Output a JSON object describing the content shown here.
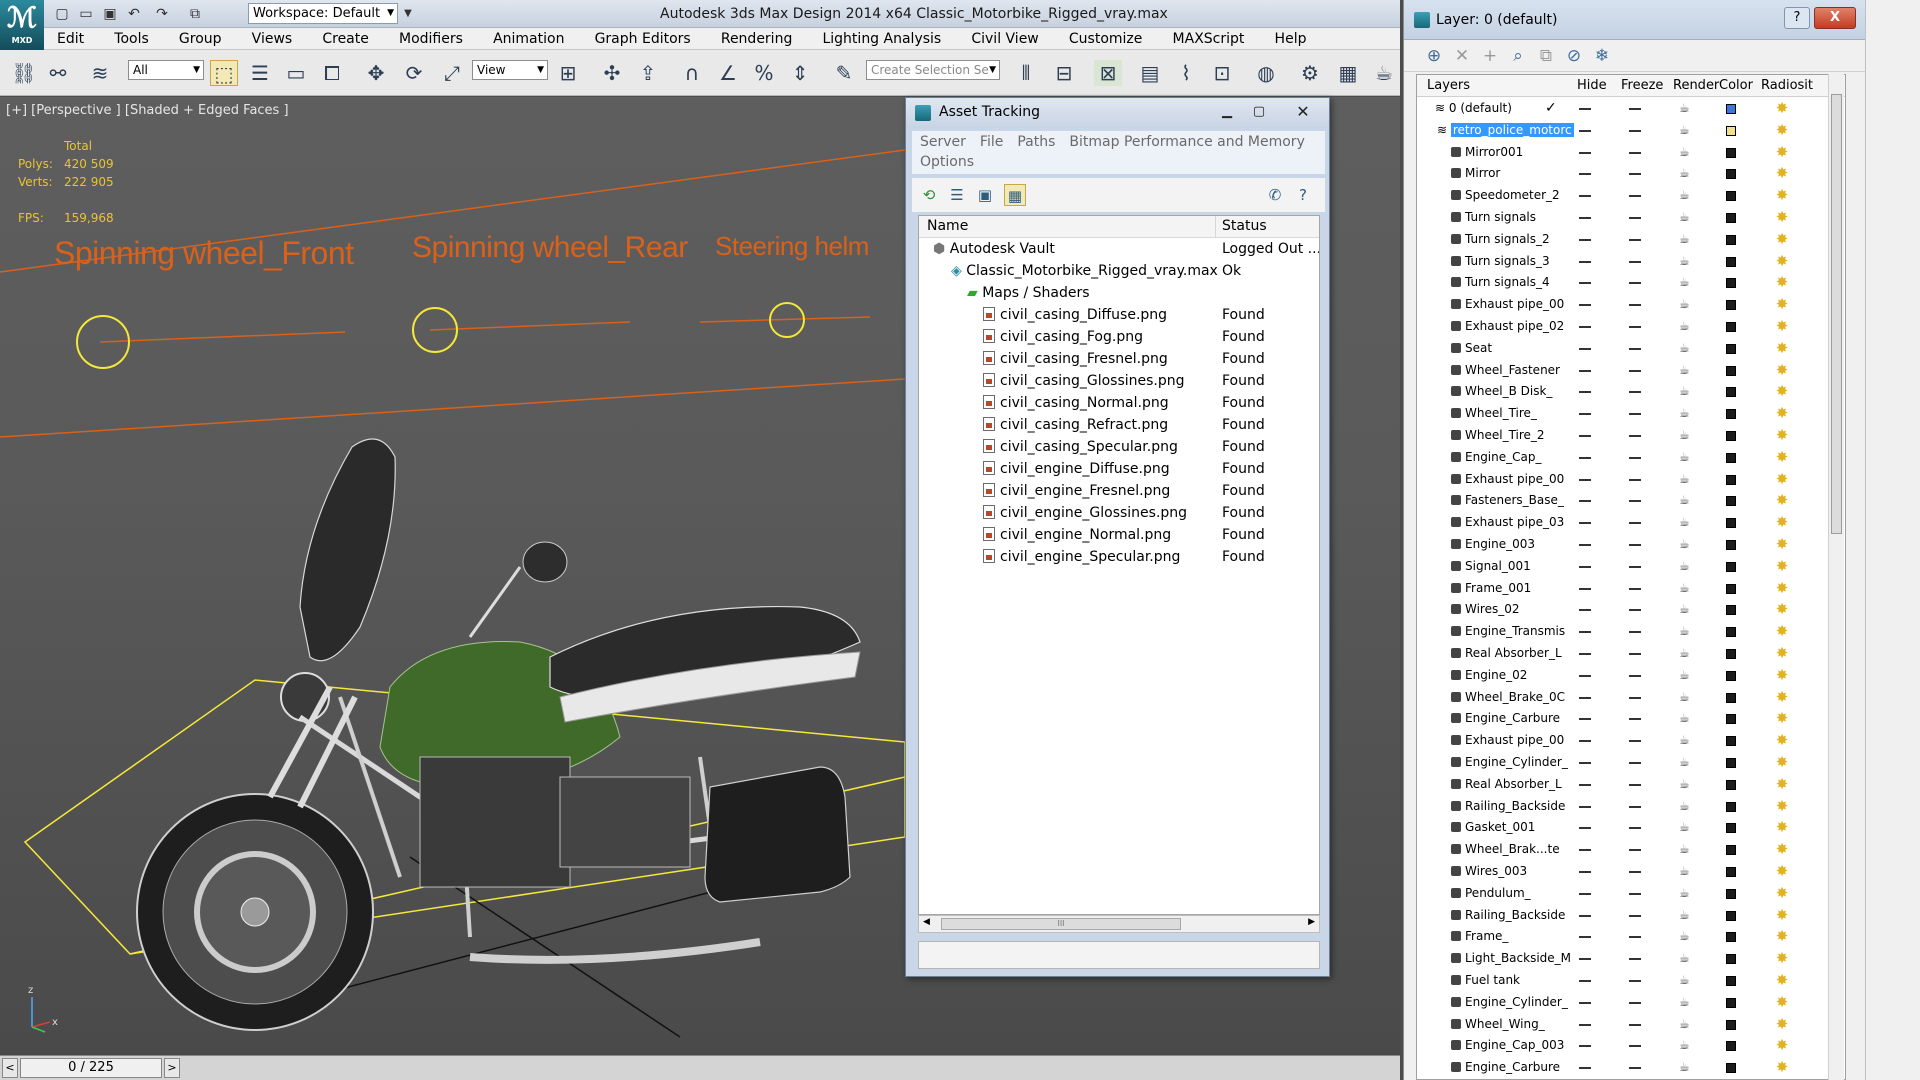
{
  "app": {
    "title": "Autodesk 3ds Max Design 2014 x64     Classic_Motorbike_Rigged_vray.max",
    "logo_label": "MXD",
    "workspace": "Workspace: Default"
  },
  "menu": [
    "Edit",
    "Tools",
    "Group",
    "Views",
    "Create",
    "Modifiers",
    "Animation",
    "Graph Editors",
    "Rendering",
    "Lighting Analysis",
    "Civil View",
    "Customize",
    "MAXScript",
    "Help"
  ],
  "toolbar": {
    "filter": "All",
    "ref_coord": "View",
    "selection_set_placeholder": "Create Selection Se"
  },
  "viewport": {
    "label": "[+] [Perspective ] [Shaded + Edged Faces ]",
    "stats": {
      "total_label": "Total",
      "polys_label": "Polys:",
      "polys": "420 509",
      "verts_label": "Verts:",
      "verts": "222 905",
      "fps_label": "FPS:",
      "fps": "159,968"
    },
    "annotations": [
      "Spinning wheel_Front",
      "Spinning wheel_Rear",
      "Steering helm"
    ],
    "axis_z": "z",
    "axis_x": "x"
  },
  "timeline": {
    "frame": "0 / 225",
    "prev": "<",
    "next": ">"
  },
  "asset_tracking": {
    "title": "Asset Tracking",
    "menu": [
      "Server",
      "File",
      "Paths",
      "Bitmap Performance and Memory",
      "Options"
    ],
    "columns": [
      "Name",
      "Status"
    ],
    "rows": [
      {
        "name": "Autodesk Vault",
        "status": "Logged Out ..."
      },
      {
        "name": "Classic_Motorbike_Rigged_vray.max",
        "status": "Ok"
      },
      {
        "name": "Maps / Shaders",
        "status": ""
      },
      {
        "name": "civil_casing_Diffuse.png",
        "status": "Found"
      },
      {
        "name": "civil_casing_Fog.png",
        "status": "Found"
      },
      {
        "name": "civil_casing_Fresnel.png",
        "status": "Found"
      },
      {
        "name": "civil_casing_Glossines.png",
        "status": "Found"
      },
      {
        "name": "civil_casing_Normal.png",
        "status": "Found"
      },
      {
        "name": "civil_casing_Refract.png",
        "status": "Found"
      },
      {
        "name": "civil_casing_Specular.png",
        "status": "Found"
      },
      {
        "name": "civil_engine_Diffuse.png",
        "status": "Found"
      },
      {
        "name": "civil_engine_Fresnel.png",
        "status": "Found"
      },
      {
        "name": "civil_engine_Glossines.png",
        "status": "Found"
      },
      {
        "name": "civil_engine_Normal.png",
        "status": "Found"
      },
      {
        "name": "civil_engine_Specular.png",
        "status": "Found"
      }
    ],
    "scroll_thumb": "III"
  },
  "layers": {
    "title": "Layer: 0 (default)",
    "help": "?",
    "close": "X",
    "columns": [
      "Layers",
      "Hide",
      "Freeze",
      "Render",
      "Color",
      "Radiosit"
    ],
    "layer_rows": [
      {
        "name": "0 (default)",
        "check": "✓",
        "color": "#3b78d8"
      },
      {
        "name": "retro_police_motorc",
        "color": "#f1e08a"
      }
    ],
    "objects": [
      "Mirror001",
      "Mirror",
      "Speedometer_2",
      "Turn signals",
      "Turn signals_2",
      "Turn signals_3",
      "Turn signals_4",
      "Exhaust pipe_00",
      "Exhaust pipe_02",
      "Seat",
      "Wheel_Fastener",
      "Wheel_B Disk_",
      "Wheel_Tire_",
      "Wheel_Tire_2",
      "Engine_Cap_",
      "Exhaust pipe_00",
      "Fasteners_Base_",
      "Exhaust pipe_03",
      "Engine_003",
      "Signal_001",
      "Frame_001",
      "Wires_02",
      "Engine_Transmis",
      "Real Absorber_L",
      "Engine_02",
      "Wheel_Brake_0C",
      "Engine_Carbure",
      "Exhaust pipe_00",
      "Engine_Cylinder_",
      "Real Absorber_L",
      "Railing_Backside",
      "Gasket_001",
      "Wheel_Brak...te",
      "Wires_003",
      "Pendulum_",
      "Railing_Backside",
      "Frame_",
      "Light_Backside_M",
      "Fuel tank",
      "Engine_Cylinder_",
      "Wheel_Wing_",
      "Engine_Cap_003",
      "Engine_Carbure"
    ]
  },
  "colors": {
    "annotation": "#d9611a",
    "stats": "#e8c530",
    "selection": "#3399ff",
    "tank": "#3f6a2a"
  }
}
